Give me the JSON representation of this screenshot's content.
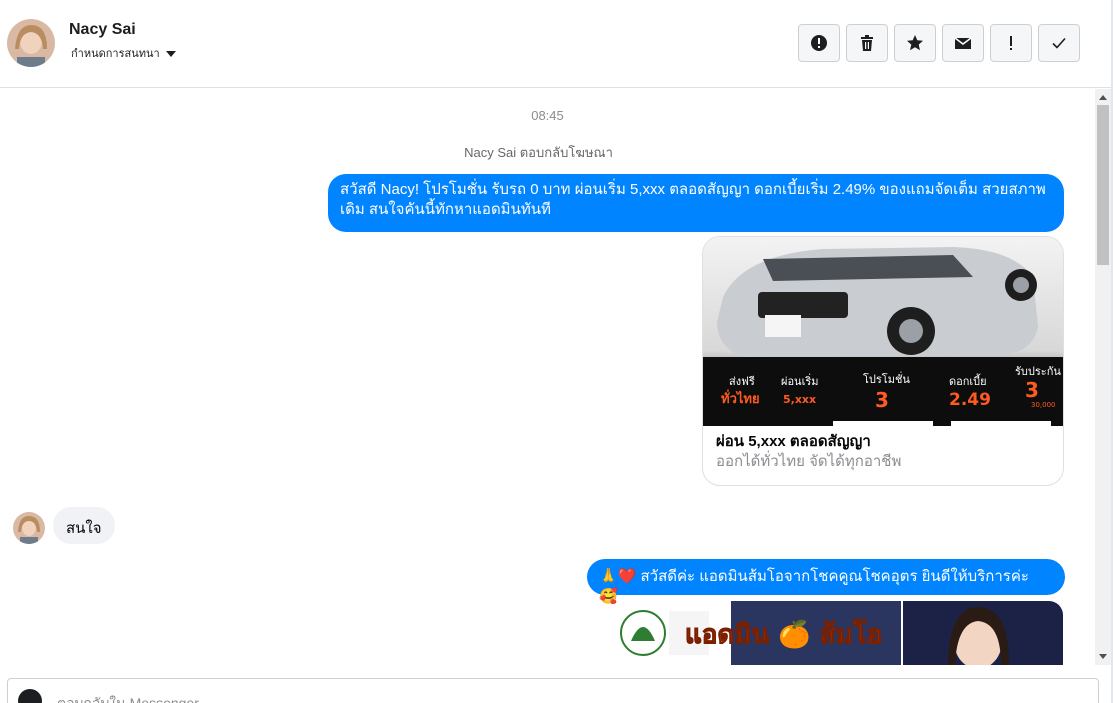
{
  "header": {
    "name": "Nacy Sai",
    "subtitle": "กำหนดการสนทนา"
  },
  "toolbar": {
    "buttons": [
      {
        "icon": "alert-circle-icon"
      },
      {
        "icon": "trash-icon"
      },
      {
        "icon": "star-icon"
      },
      {
        "icon": "envelope-icon"
      },
      {
        "icon": "exclamation-icon"
      },
      {
        "icon": "check-icon"
      }
    ]
  },
  "conversation": {
    "time": "08:45",
    "reply_note": "Nacy Sai ตอบกลับโฆษณา",
    "msg1": "สวัสดี Nacy! โปรโมชั่น รับรถ 0 บาท ผ่อนเริ่ม 5,xxx ตลอดสัญญา ดอกเบี้ยเริ่ม 2.49% ของแถมจัดเต็ม สวยสภาพเดิม สนใจคันนี้ทักหาแอดมินทันที",
    "card": {
      "title": "ผ่อน 5,xxx ตลอดสัญญา",
      "subtitle": "ออกได้ทั่วไทย จัดได้ทุกอาชีพ",
      "promo": {
        "free_label": "ส่งฟรี",
        "free_value": "ทั่วไทย",
        "installment_label": "ผ่อนเริ่ม",
        "installment_value": "5,xxx",
        "promo_label": "โปรโมชั่น",
        "promo_value": "3",
        "interest_label": "ดอกเบี้ย",
        "interest_value": "2.49",
        "insurance_label": "รับประกัน",
        "insurance_value": "3",
        "insurance_sub": "30,000"
      }
    },
    "incoming": "สนใจ",
    "msg2": "🙏❤️ สวัสดีค่ะ แอดมินส้มโอจากโชคคูณโชคอุตร ยินดีให้บริการค่ะ 🥰.",
    "banner_text": "แอดมิน 🍊 ส้มโอ"
  },
  "composer": {
    "placeholder": "ตอบกลับใน Messenger"
  },
  "colors": {
    "brand_blue": "#0084ff",
    "incoming_bg": "#f0f2f5",
    "promo_orange": "#ff5a1f"
  }
}
